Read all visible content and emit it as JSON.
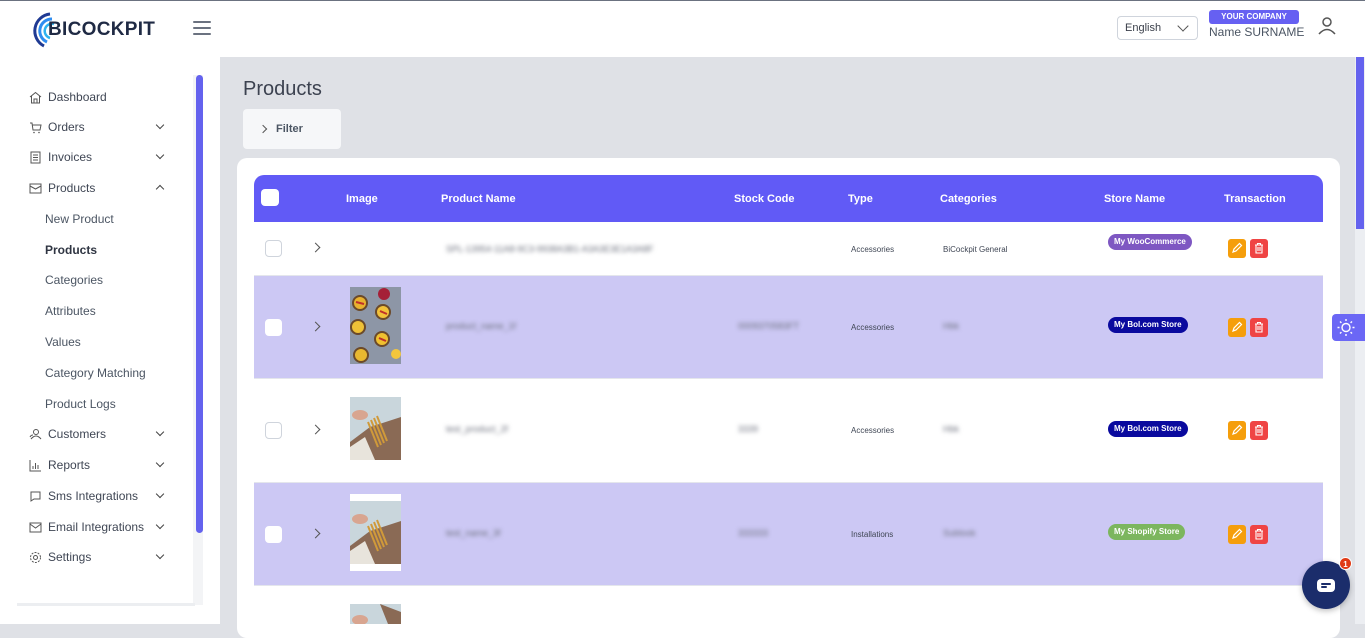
{
  "header": {
    "logo_text": "BICOCKPIT",
    "language": "English",
    "company_badge": "YOUR COMPANY",
    "user_name": "Name SURNAME"
  },
  "sidebar": {
    "items": [
      {
        "label": "Dashboard",
        "icon": "home-icon"
      },
      {
        "label": "Orders",
        "icon": "cart-icon",
        "expandable": true
      },
      {
        "label": "Invoices",
        "icon": "invoice-icon",
        "expandable": true
      },
      {
        "label": "Products",
        "icon": "box-icon",
        "expandable": true,
        "expanded": true
      },
      {
        "label": "Customers",
        "icon": "users-icon",
        "expandable": true
      },
      {
        "label": "Reports",
        "icon": "chart-icon",
        "expandable": true
      },
      {
        "label": "Sms Integrations",
        "icon": "chat-icon",
        "expandable": true
      },
      {
        "label": "Email Integrations",
        "icon": "mail-icon",
        "expandable": true
      },
      {
        "label": "Settings",
        "icon": "gear-icon",
        "expandable": true
      }
    ],
    "product_subitems": [
      {
        "label": "New Product"
      },
      {
        "label": "Products",
        "active": true
      },
      {
        "label": "Categories"
      },
      {
        "label": "Attributes"
      },
      {
        "label": "Values"
      },
      {
        "label": "Category Matching"
      },
      {
        "label": "Product Logs"
      }
    ]
  },
  "main": {
    "title": "Products",
    "filter_label": "Filter",
    "table": {
      "columns": [
        "Image",
        "Product Name",
        "Stock Code",
        "Type",
        "Categories",
        "Store Name",
        "Transaction"
      ],
      "rows": [
        {
          "image": "none",
          "product_name": "SPL-13954-11A8-9C3-9938A3B1-A3A3E3E1A3A8F",
          "stock_code": "",
          "type": "Accessories",
          "categories": "BiCockpit General",
          "store": "My WooCommerce",
          "store_color": "#7e57c2"
        },
        {
          "image": "tarts",
          "product_name": "product_name_1f",
          "stock_code": "0009370583FT",
          "type": "Accessories",
          "categories": "Hbk",
          "store": "My Bol.com Store",
          "store_color": "#0a0a9e"
        },
        {
          "image": "bracelets",
          "product_name": "test_product_2f",
          "stock_code": "3339",
          "type": "Accessories",
          "categories": "Hbk",
          "store": "My Bol.com Store",
          "store_color": "#0a0a9e"
        },
        {
          "image": "bracelets",
          "product_name": "test_name_3f",
          "stock_code": "333333",
          "type": "Installations",
          "categories": "Sublook",
          "store": "My Shopify Store",
          "store_color": "#7cb65e"
        },
        {
          "image": "bracelets",
          "product_name": "",
          "stock_code": "",
          "type": "",
          "categories": "",
          "store": "",
          "store_color": ""
        }
      ]
    }
  },
  "chat": {
    "unread_count": "1"
  },
  "colors": {
    "accent": "#615af6",
    "row_alt": "#ccc8f4",
    "edit": "#f59e0b",
    "delete": "#ef4444"
  }
}
